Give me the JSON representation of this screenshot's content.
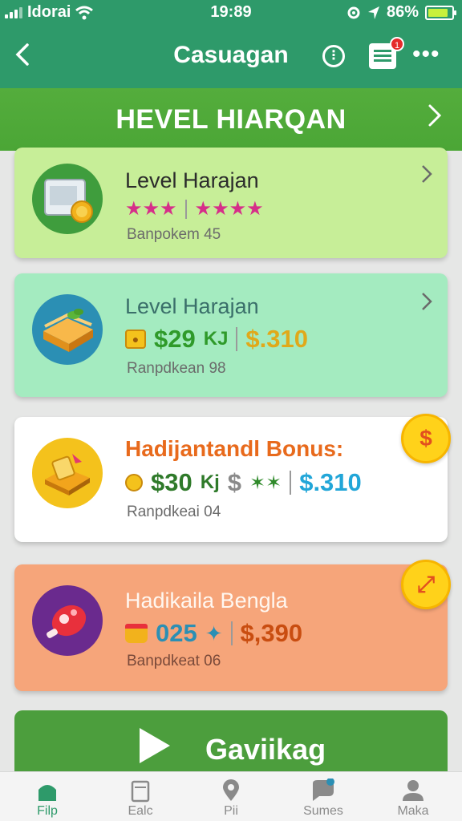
{
  "status_bar": {
    "carrier": "Idorai",
    "time": "19:89",
    "battery_percent": "86%",
    "battery_level": 0.86
  },
  "app_bar": {
    "title": "Casuagan",
    "notification_count": "1"
  },
  "section_header": {
    "title": "HEVEL HIARQAN"
  },
  "cards": [
    {
      "title": "Level Harajan",
      "subtitle": "Banpokem 45",
      "icon": "gift-box-icon",
      "stars_left": "★★★",
      "stars_right": "★★★★",
      "bg": "#c7ee98"
    },
    {
      "title": "Level Harajan",
      "subtitle": "Ranpdkean 98",
      "icon": "cake-icon",
      "value_primary": "$29",
      "value_primary_suffix": "KJ",
      "value_secondary": "$.310",
      "bg": "#a4ebc0"
    },
    {
      "title": "Hadijantandl Bonus:",
      "subtitle": "Ranpdkeai 04",
      "icon": "gold-bars-icon",
      "value_primary": "$30",
      "value_primary_suffix": "Kj",
      "value_mid": "$",
      "value_secondary": "$.310",
      "badge": "$",
      "bg": "#ffffff"
    },
    {
      "title": "Hadikaila Bengla",
      "subtitle": "Banpdkeat 06",
      "icon": "candy-icon",
      "value_primary": "025",
      "value_secondary": "$,390",
      "badge": "⤢",
      "bg": "#f6a57a"
    }
  ],
  "cta": {
    "label": "Gaviikag"
  },
  "bottom_nav": [
    {
      "label": "Filp",
      "icon": "home-icon",
      "active": true
    },
    {
      "label": "Ealc",
      "icon": "calendar-icon",
      "active": false
    },
    {
      "label": "Pii",
      "icon": "location-pin-icon",
      "active": false
    },
    {
      "label": "Sumes",
      "icon": "chat-icon",
      "active": false
    },
    {
      "label": "Maka",
      "icon": "person-icon",
      "active": false
    }
  ],
  "colors": {
    "primary": "#2e9a6a",
    "section": "#54ad3c",
    "star": "#d62e89",
    "green_value": "#2f9a2a",
    "gold_value": "#e0a91a",
    "blue_value": "#22a6d8",
    "orange_value": "#c94d10"
  }
}
